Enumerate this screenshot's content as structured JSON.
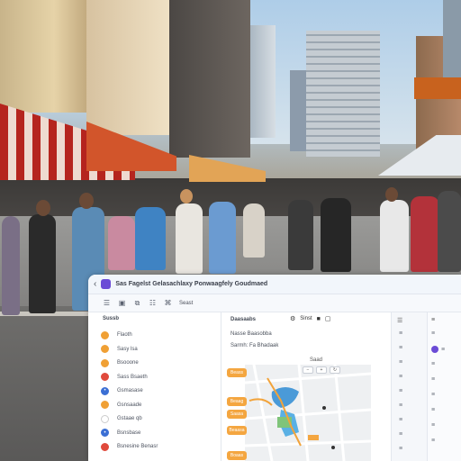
{
  "window": {
    "back_icon": "chevron-left-icon",
    "title": "Sas Fagelst Gelasachlaxy Ponwaagfely Goudmaed"
  },
  "toolbar": {
    "items": [
      {
        "icon": "☰",
        "name": "menu-icon"
      },
      {
        "icon": "▣",
        "name": "view-icon"
      },
      {
        "icon": "⧉",
        "name": "copy-icon"
      },
      {
        "icon": "☷",
        "name": "list-icon"
      },
      {
        "icon": "⌘",
        "name": "command-icon"
      }
    ],
    "label": "Seast"
  },
  "sidebar": {
    "heading": "Sussb",
    "items": [
      {
        "label": "Flaoth",
        "color": "#f0a035",
        "symbol": ""
      },
      {
        "label": "Sasy lsa",
        "color": "#f0a035",
        "symbol": ""
      },
      {
        "label": "Bsooone",
        "color": "#f0a035",
        "symbol": ""
      },
      {
        "label": "Sass Bsaeth",
        "color": "#e04a3c",
        "symbol": ""
      },
      {
        "label": "Gsmasase",
        "color": "#3b6fd4",
        "symbol": "•"
      },
      {
        "label": "Gsnsaade",
        "color": "#f0a035",
        "symbol": ""
      },
      {
        "label": "Gstaae qb",
        "color": "#ffffff",
        "symbol": ""
      },
      {
        "label": "Bsnsbase",
        "color": "#3b6fd4",
        "symbol": "•"
      },
      {
        "label": "Bsnesine Benasr",
        "color": "#e04a3c",
        "symbol": ""
      }
    ]
  },
  "main": {
    "heading": "Daasaabs",
    "actions": [
      {
        "icon": "⚙",
        "label": "Sinst"
      },
      {
        "icon": "■",
        "label": ""
      },
      {
        "icon": "▢",
        "label": ""
      }
    ],
    "rows": [
      "Nasse Baasobba",
      "Sarmh: Fa Bhadaak"
    ],
    "map_label": "Saad",
    "map_tools": [
      "−",
      "+",
      "↻"
    ],
    "tags": [
      "Beass",
      "Beaag",
      "Saasa",
      "Beaasa",
      "Boaas"
    ]
  },
  "right_panel": {
    "heading": "☰",
    "icons": [
      "≡",
      "≡",
      "≡",
      "≡",
      "≡",
      "≡",
      "≡",
      "≡",
      "≡"
    ]
  },
  "far_right": {
    "heading": "≡",
    "rows": [
      "≡",
      "≡",
      "≡",
      "≡",
      "≡",
      "≡",
      "≡",
      "≡"
    ]
  },
  "colors": {
    "accent": "#6b4bd6",
    "orange_tag": "#f4a640",
    "map_water": "#4a9ad8",
    "map_route": "#f2a33a"
  }
}
